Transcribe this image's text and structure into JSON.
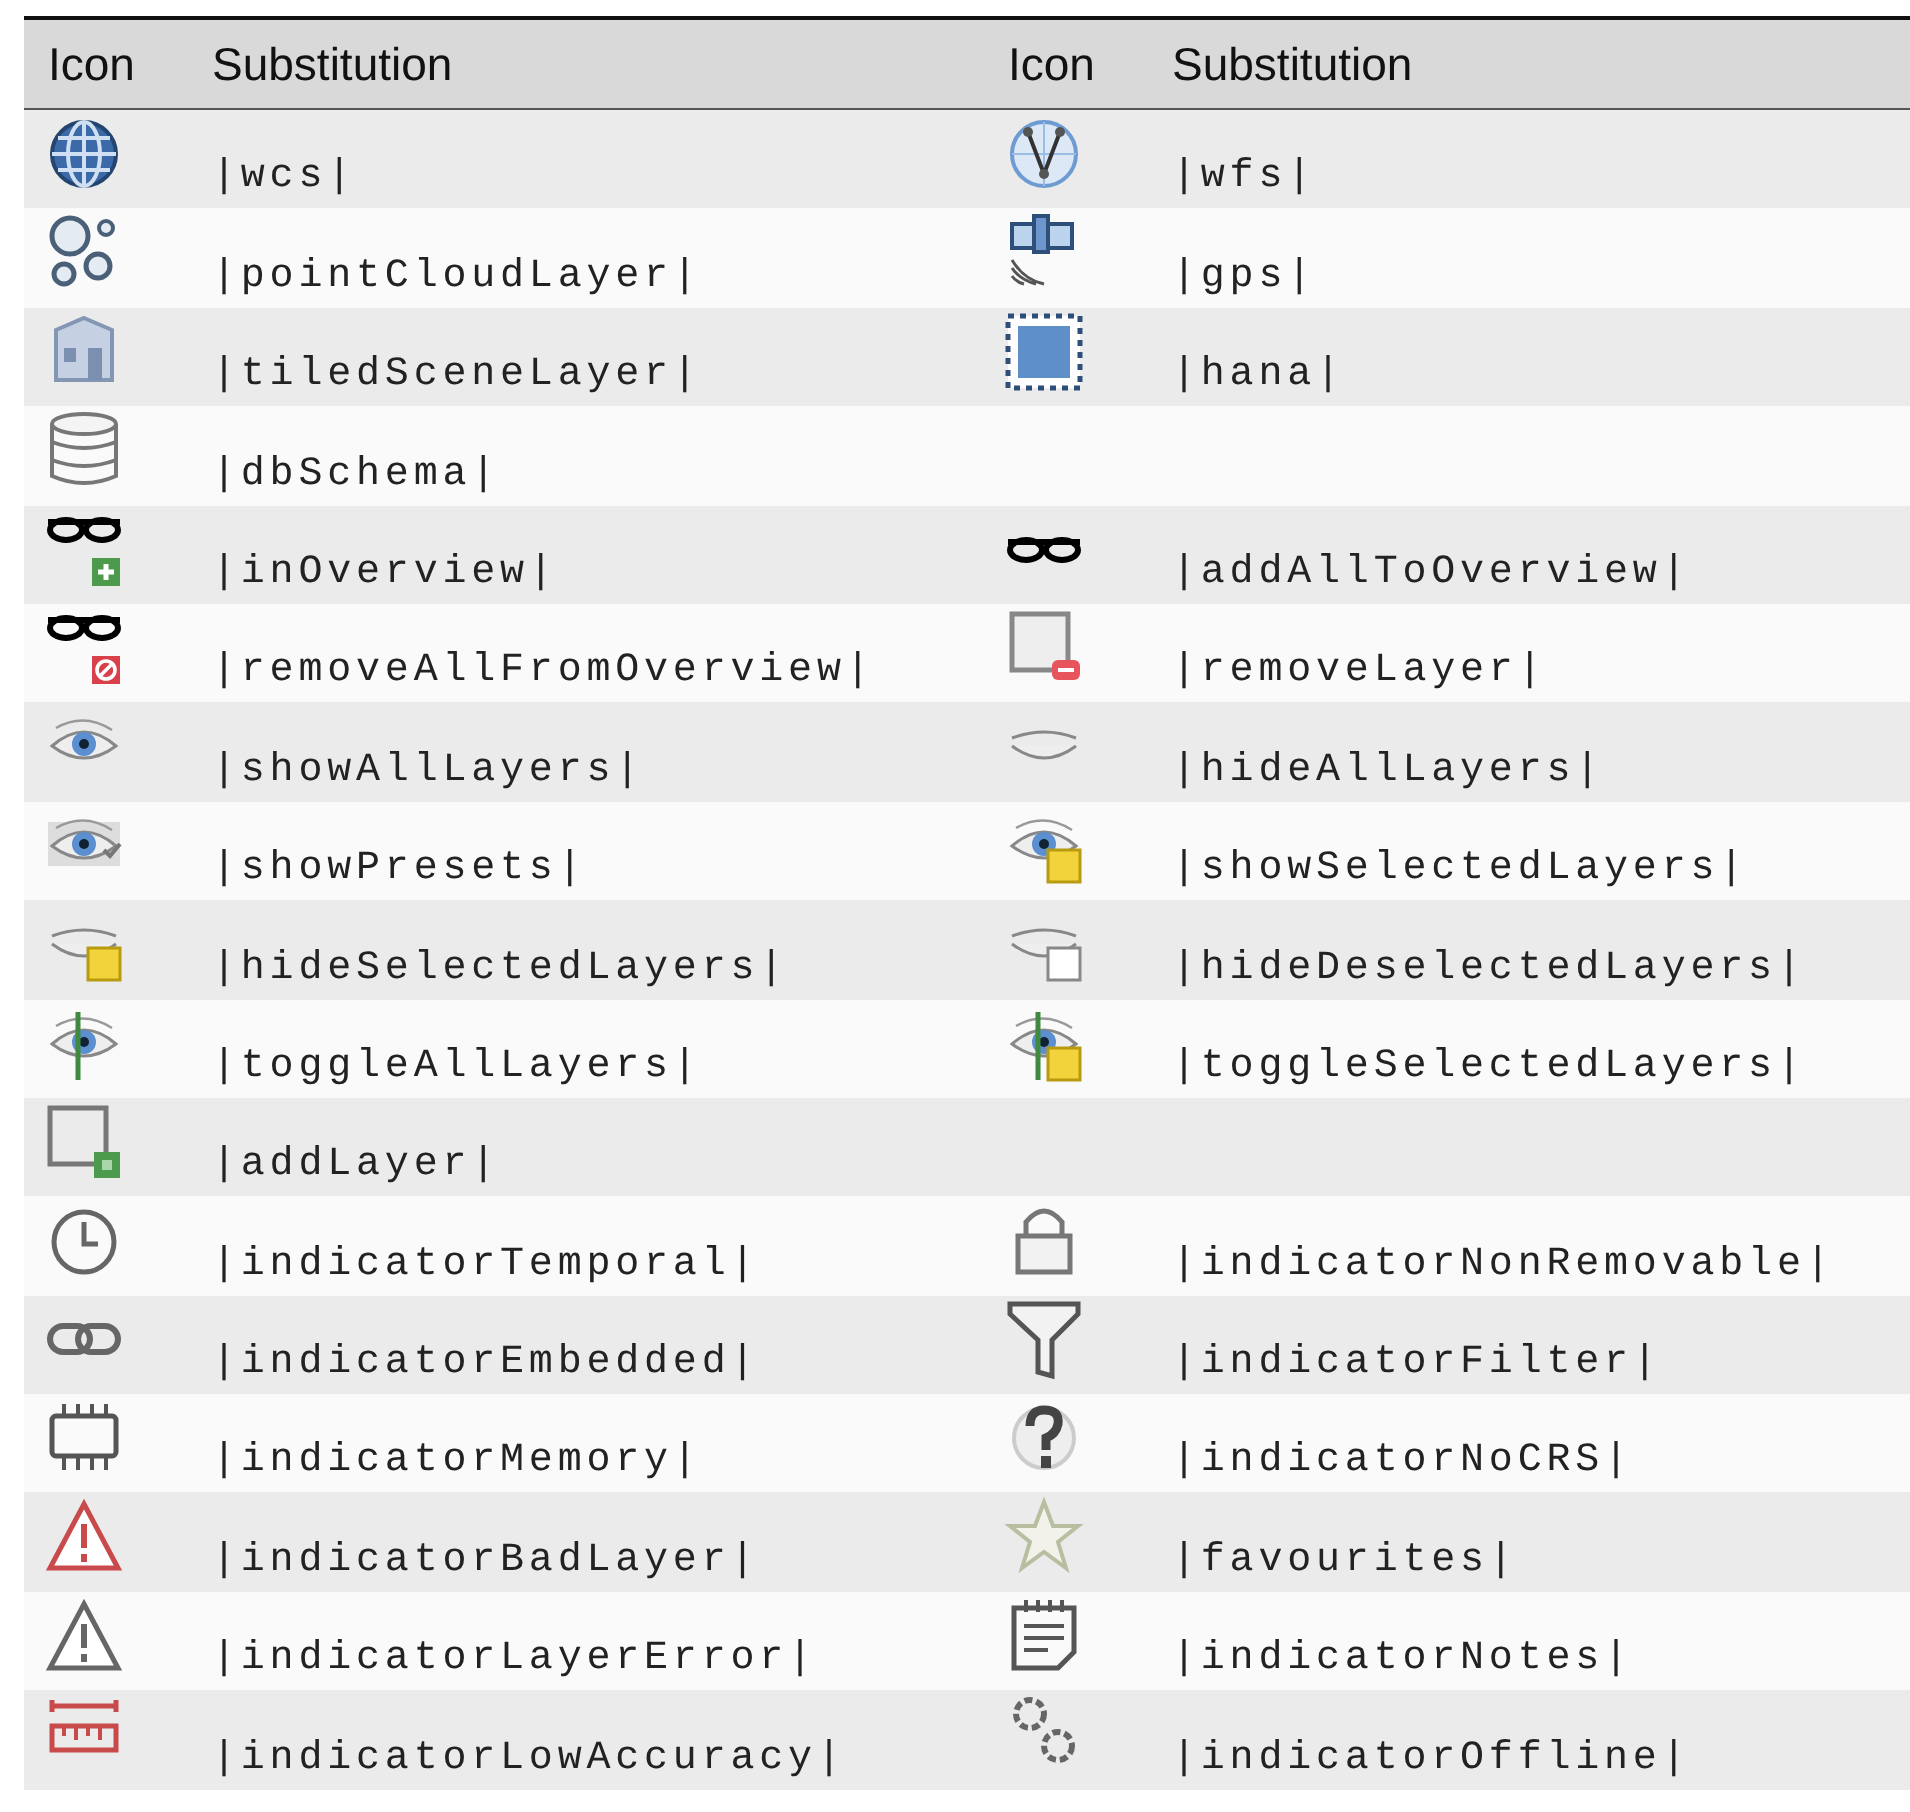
{
  "table": {
    "columns": [
      "Icon",
      "Substitution",
      "Icon",
      "Substitution"
    ],
    "rows": [
      {
        "left": "|wcs|",
        "right": "|wfs|"
      },
      {
        "left": "|pointCloudLayer|",
        "right": "|gps|"
      },
      {
        "left": "|tiledSceneLayer|",
        "right": "|hana|"
      },
      {
        "left": "|dbSchema|"
      },
      {
        "left": "|inOverview|",
        "right": "|addAllToOverview|"
      },
      {
        "left": "|removeAllFromOverview|",
        "right": "|removeLayer|"
      },
      {
        "left": "|showAllLayers|",
        "right": "|hideAllLayers|"
      },
      {
        "left": "|showPresets|",
        "right": "|showSelectedLayers|"
      },
      {
        "left": "|hideSelectedLayers|",
        "right": "|hideDeselectedLayers|"
      },
      {
        "left": "|toggleAllLayers|",
        "right": "|toggleSelectedLayers|"
      },
      {
        "left": "|addLayer|"
      },
      {
        "left": "|indicatorTemporal|",
        "right": "|indicatorNonRemovable|"
      },
      {
        "left": "|indicatorEmbedded|",
        "right": "|indicatorFilter|"
      },
      {
        "left": "|indicatorMemory|",
        "right": "|indicatorNoCRS|"
      },
      {
        "left": "|indicatorBadLayer|",
        "right": "|favourites|"
      },
      {
        "left": "|indicatorLayerError|",
        "right": "|indicatorNotes|"
      },
      {
        "left": "|indicatorLowAccuracy|",
        "right": "|indicatorOffline|"
      }
    ]
  }
}
